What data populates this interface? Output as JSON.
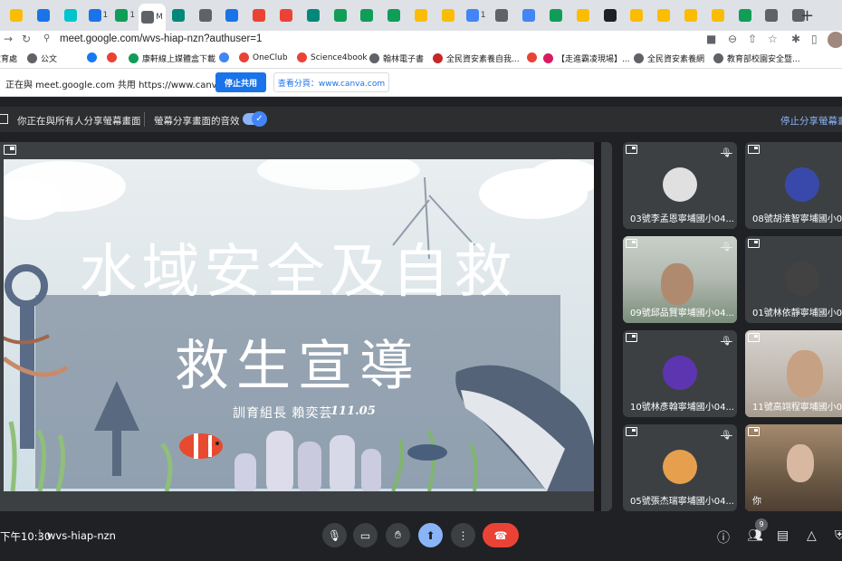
{
  "browser": {
    "tabs": [
      {
        "icon": "chrome-icon",
        "color": "#fbbc04",
        "label": ""
      },
      {
        "icon": "edge-icon",
        "color": "#1a73e8",
        "label": ""
      },
      {
        "icon": "canva-icon",
        "color": "#00c4cc",
        "label": ""
      },
      {
        "icon": "meet-present-icon",
        "color": "#1a73e8",
        "label": "1"
      },
      {
        "icon": "classroom-icon",
        "color": "#0f9d58",
        "label": "1"
      },
      {
        "icon": "meet-icon",
        "color": "#5f6368",
        "label": "M"
      },
      {
        "icon": "dots-icon",
        "color": "#00897b",
        "label": ""
      },
      {
        "icon": "globe-icon",
        "color": "#5f6368",
        "label": ""
      },
      {
        "icon": "grid-icon",
        "color": "#1a73e8",
        "label": ""
      },
      {
        "icon": "a-icon",
        "color": "#ea4335",
        "label": ""
      },
      {
        "icon": "a-icon",
        "color": "#ea4335",
        "label": ""
      },
      {
        "icon": "a-icon",
        "color": "#00897b",
        "label": ""
      },
      {
        "icon": "pk-icon",
        "color": "#0f9d58",
        "label": ""
      },
      {
        "icon": "square-icon",
        "color": "#0f9d58",
        "label": ""
      },
      {
        "icon": "square-icon",
        "color": "#0f9d58",
        "label": ""
      },
      {
        "icon": "bookmark-icon",
        "color": "#fbbc04",
        "label": ""
      },
      {
        "icon": "bookmark-icon",
        "color": "#fbbc04",
        "label": ""
      },
      {
        "icon": "docs-icon",
        "color": "#4285f4",
        "label": "1"
      },
      {
        "icon": "globe-icon",
        "color": "#5f6368",
        "label": ""
      },
      {
        "icon": "robot-icon",
        "color": "#4285f4",
        "label": ""
      },
      {
        "icon": "tree-icon",
        "color": "#0f9d58",
        "label": ""
      },
      {
        "icon": "bookmark-icon",
        "color": "#fbbc04",
        "label": ""
      },
      {
        "icon": "game-icon",
        "color": "#202124",
        "label": ""
      },
      {
        "icon": "bookmark-icon",
        "color": "#fbbc04",
        "label": ""
      },
      {
        "icon": "bookmark-icon",
        "color": "#fbbc04",
        "label": ""
      },
      {
        "icon": "bookmark-icon",
        "color": "#fbbc04",
        "label": ""
      },
      {
        "icon": "bookmark-icon",
        "color": "#fbbc04",
        "label": ""
      },
      {
        "icon": "refresh-icon",
        "color": "#0f9d58",
        "label": ""
      },
      {
        "icon": "globe-icon",
        "color": "#5f6368",
        "label": ""
      },
      {
        "icon": "globe-icon",
        "color": "#5f6368",
        "label": ""
      }
    ],
    "new_tab": "+",
    "url": "meet.google.com/wvs-hiap-nzn?authuser=1",
    "bookmarks": [
      {
        "label": "教育處",
        "color": "#4285f4"
      },
      {
        "label": "公文",
        "color": "#5f6368"
      },
      {
        "label": "",
        "color": "#1877f2"
      },
      {
        "label": "",
        "color": "#ea4335"
      },
      {
        "label": "康軒線上媒體盒下載",
        "color": "#0f9d58"
      },
      {
        "label": "",
        "color": "#4285f4"
      },
      {
        "label": "OneClub",
        "color": "#ea4335"
      },
      {
        "label": "Science4book",
        "color": "#ea4335"
      },
      {
        "label": "翰林電子書",
        "color": "#5f6368"
      },
      {
        "label": "全民資安素養自我...",
        "color": "#c62828"
      },
      {
        "label": "",
        "color": "#ea4335"
      },
      {
        "label": "【走進霸凌現場】...",
        "color": "#d81b60"
      },
      {
        "label": "全民資安素養網",
        "color": "#5f6368"
      },
      {
        "label": "教育部校園安全暨...",
        "color": "#5f6368"
      }
    ],
    "share_bar": {
      "text": "正在與 meet.google.com 共用 https://www.canva.com",
      "stop_label": "停止共用",
      "view_label": "查看分頁：www.canva.com"
    }
  },
  "meet": {
    "banner": {
      "presenting_text": "你正在與所有人分享螢幕畫面",
      "audio_text": "螢幕分享畫面的音效",
      "stop_label": "停止分享螢幕畫面"
    },
    "slide": {
      "title": "水域安全及自救",
      "subtitle": "救生宣導",
      "author": "訓育組長 賴奕芸",
      "date": "111.05"
    },
    "participants": [
      {
        "name": "03號李孟恩寧埔國小04...",
        "muted": true,
        "avatar_color": "#e0e0e0"
      },
      {
        "name": "08號胡淮智寧埔國小04...",
        "muted": true,
        "avatar_color": "#3949ab"
      },
      {
        "name": "09號邱品賢寧埔國小04...",
        "muted": true,
        "avatar_color": "#8d6e63"
      },
      {
        "name": "01號林依靜寧埔國小04...",
        "muted": true,
        "avatar_color": "#424242"
      },
      {
        "name": "10號林彥翰寧埔國小04...",
        "muted": true,
        "avatar_color": "#5e35b1"
      },
      {
        "name": "11號高翊程寧埔國小04...",
        "muted": false,
        "avatar_color": "#a1887f"
      },
      {
        "name": "05號張杰瑞寧埔國小04...",
        "muted": true,
        "avatar_color": "#e6a04d"
      },
      {
        "name": "你",
        "muted": false,
        "avatar_color": "#8d6e63"
      }
    ],
    "bottom": {
      "time": "下午10:30",
      "meeting_code": "wvs-hiap-nzn",
      "participant_count": "9"
    }
  }
}
